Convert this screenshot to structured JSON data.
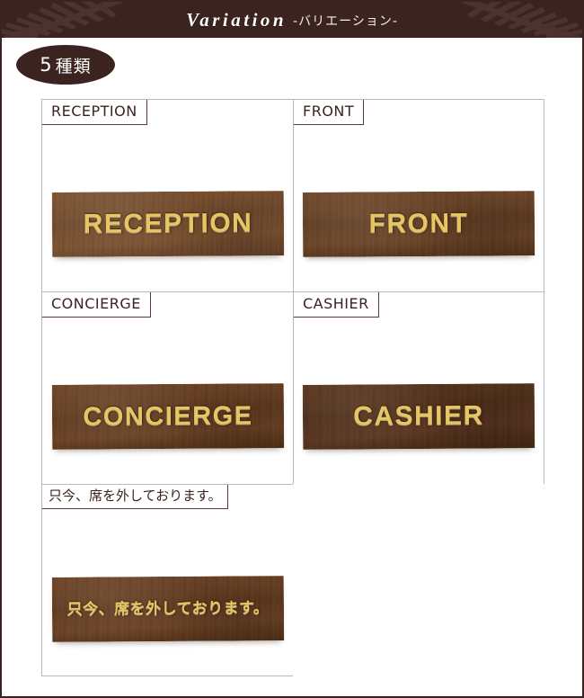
{
  "header": {
    "title_en": "Variation",
    "title_jp": "-バリエーション-",
    "bg_color": "#3b2420",
    "frond_color": "#4d3330"
  },
  "badge": {
    "number": "5",
    "unit": "種類",
    "bg_color": "#3b2420",
    "text_color": "#ffffff"
  },
  "variations": [
    {
      "label": "RECEPTION",
      "plaque_text": "RECEPTION",
      "wood_tone": "#6d462a",
      "engrave_color": "#e6c565"
    },
    {
      "label": "FRONT",
      "plaque_text": "FRONT",
      "wood_tone": "#5e3b22",
      "engrave_color": "#e6c565"
    },
    {
      "label": "CONCIERGE",
      "plaque_text": "CONCIERGE",
      "wood_tone": "#6a4127",
      "engrave_color": "#e6c565"
    },
    {
      "label": "CASHIER",
      "plaque_text": "CASHIER",
      "wood_tone": "#4c2d18",
      "engrave_color": "#e6c565"
    },
    {
      "label": "只今、席を外しております。",
      "plaque_text": "只今、席を外しております。",
      "wood_tone": "#5c371d",
      "engrave_color": "#e6c565"
    }
  ],
  "grid": {
    "border_color": "#b9b9b9",
    "label_border_color": "#5a3a30",
    "label_text_color": "#3b2420"
  }
}
